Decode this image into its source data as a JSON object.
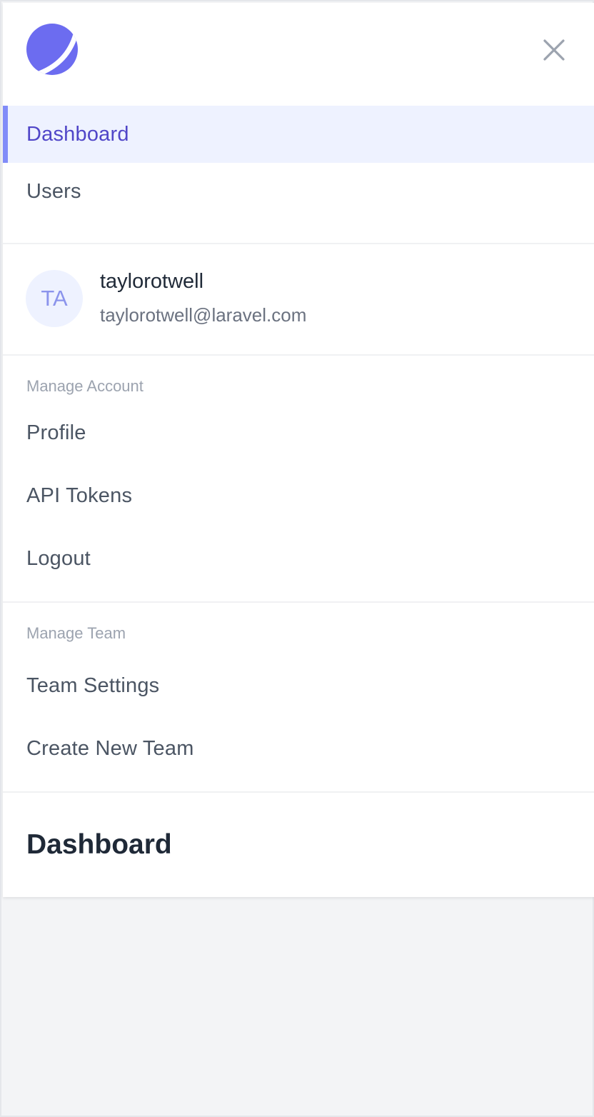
{
  "nav": {
    "primary": [
      {
        "label": "Dashboard",
        "active": true
      },
      {
        "label": "Users",
        "active": false
      }
    ]
  },
  "user": {
    "initials": "TA",
    "name": "taylorotwell",
    "email": "taylorotwell@laravel.com"
  },
  "account": {
    "header": "Manage Account",
    "items": [
      "Profile",
      "API Tokens",
      "Logout"
    ]
  },
  "team": {
    "header": "Manage Team",
    "items": [
      "Team Settings",
      "Create New Team"
    ]
  },
  "page": {
    "title": "Dashboard"
  },
  "colors": {
    "accent": "#5046c8",
    "accent_light": "#eef2ff",
    "logo": "#6c6cf0"
  },
  "icons": {
    "logo": "logo-icon",
    "close": "close-icon"
  }
}
